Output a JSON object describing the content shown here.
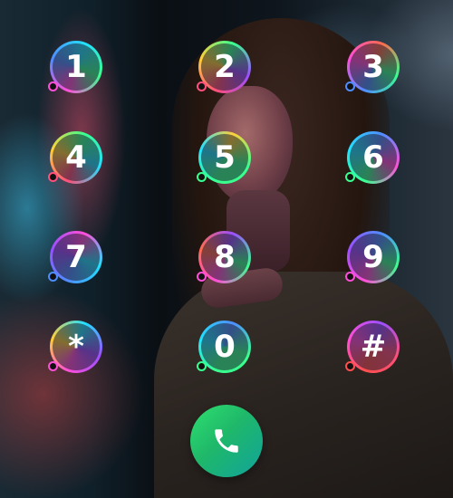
{
  "dialpad": {
    "keys": [
      {
        "label": "1",
        "ring": [
          "#ff4fd8",
          "#4f8dff",
          "#22e0ff",
          "#39ff8f"
        ]
      },
      {
        "label": "2",
        "ring": [
          "#ff4f7a",
          "#ffcf3a",
          "#39ff8f",
          "#9b4fff"
        ]
      },
      {
        "label": "3",
        "ring": [
          "#4f8dff",
          "#ff4fd8",
          "#ff6a4f",
          "#39ff8f"
        ]
      },
      {
        "label": "4",
        "ring": [
          "#ff4f7a",
          "#ffd23a",
          "#39ff8f",
          "#22e0ff"
        ]
      },
      {
        "label": "5",
        "ring": [
          "#39ff8f",
          "#22e0ff",
          "#ffcf3a",
          "#39ff8f"
        ]
      },
      {
        "label": "6",
        "ring": [
          "#39ff8f",
          "#22e0ff",
          "#4f8dff",
          "#ff4fd8"
        ]
      },
      {
        "label": "7",
        "ring": [
          "#4f8dff",
          "#9b4fff",
          "#ff4fd8",
          "#22e0ff"
        ]
      },
      {
        "label": "8",
        "ring": [
          "#ff4fd8",
          "#ff6a4f",
          "#9b4fff",
          "#39ff8f"
        ]
      },
      {
        "label": "9",
        "ring": [
          "#ff4fd8",
          "#9b4fff",
          "#4f8dff",
          "#39ff8f"
        ]
      },
      {
        "label": "*",
        "ring": [
          "#ff4fd8",
          "#ffcf3a",
          "#22e0ff",
          "#9b4fff"
        ]
      },
      {
        "label": "0",
        "ring": [
          "#39ff8f",
          "#22e0ff",
          "#4f8dff",
          "#39ff8f"
        ]
      },
      {
        "label": "#",
        "ring": [
          "#ff4f4f",
          "#ff4fd8",
          "#9b4fff",
          "#ff4f7a"
        ]
      }
    ]
  },
  "call_button": {
    "icon": "phone-icon",
    "colors": [
      "#2fe06f",
      "#11a39c"
    ]
  }
}
